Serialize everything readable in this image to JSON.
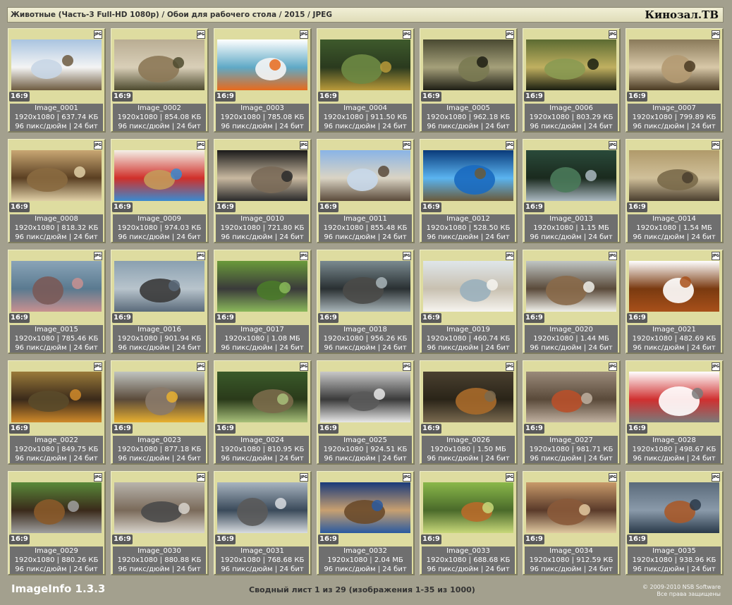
{
  "header": {
    "title": "Животные (Часть-3 Full-HD 1080p) / Обои для рабочего стола / 2015 / JPEG",
    "brand": "Кинозал.ТВ"
  },
  "footer": {
    "app_name": "ImageInfo 1.3.3",
    "summary": "Сводный лист 1 из 29 (изображения 1-35 из 1000)",
    "copyright_line1": "© 2009-2010 NSB Software",
    "copyright_line2": "Все права защищены"
  },
  "format_badge": "JPG",
  "images": [
    {
      "name": "Image_0001",
      "dims": "1920x1080",
      "size": "637.74 КБ",
      "ratio": "16:9",
      "dpi": "96 пикс/дюйм",
      "bits": "24 бит",
      "colors": [
        "#a9c4e0",
        "#c8d6e6",
        "#6d5b3f",
        "#f4f4f4"
      ]
    },
    {
      "name": "Image_0002",
      "dims": "1920x1080",
      "size": "854.08 КБ",
      "ratio": "16:9",
      "dpi": "96 пикс/дюйм",
      "bits": "24 бит",
      "colors": [
        "#b9ad93",
        "#8c7856",
        "#4d4a2e",
        "#d9cfb8"
      ]
    },
    {
      "name": "Image_0003",
      "dims": "1920x1080",
      "size": "785.08 КБ",
      "ratio": "16:9",
      "dpi": "96 пикс/дюйм",
      "bits": "24 бит",
      "colors": [
        "#ffffff",
        "#f5f5f5",
        "#e86a1c",
        "#5fa9c6"
      ]
    },
    {
      "name": "Image_0004",
      "dims": "1920x1080",
      "size": "911.50 КБ",
      "ratio": "16:9",
      "dpi": "96 пикс/дюйм",
      "bits": "24 бит",
      "colors": [
        "#3e5a2c",
        "#6e8a44",
        "#b99a3a",
        "#2a3a1e"
      ]
    },
    {
      "name": "Image_0005",
      "dims": "1920x1080",
      "size": "962.18 КБ",
      "ratio": "16:9",
      "dpi": "96 пикс/дюйм",
      "bits": "24 бит",
      "colors": [
        "#4a4a32",
        "#7a7a52",
        "#1e1e14",
        "#a5a07a"
      ]
    },
    {
      "name": "Image_0006",
      "dims": "1920x1080",
      "size": "803.29 КБ",
      "ratio": "16:9",
      "dpi": "96 пикс/дюйм",
      "bits": "24 бит",
      "colors": [
        "#5c6b32",
        "#8a9a52",
        "#1a1e10",
        "#c0b060"
      ]
    },
    {
      "name": "Image_0007",
      "dims": "1920x1080",
      "size": "799.89 КБ",
      "ratio": "16:9",
      "dpi": "96 пикс/дюйм",
      "bits": "24 бит",
      "colors": [
        "#8a7a5a",
        "#b49a72",
        "#4a3a22",
        "#d8c8a8"
      ]
    },
    {
      "name": "Image_0008",
      "dims": "1920x1080",
      "size": "818.32 КБ",
      "ratio": "16:9",
      "dpi": "96 пикс/дюйм",
      "bits": "24 бит",
      "colors": [
        "#c9a773",
        "#8a6a40",
        "#e0cfa6",
        "#5a3f22"
      ]
    },
    {
      "name": "Image_0009",
      "dims": "1920x1080",
      "size": "974.03 КБ",
      "ratio": "16:9",
      "dpi": "96 пикс/дюйм",
      "bits": "24 бит",
      "colors": [
        "#f4f0e8",
        "#c49a5a",
        "#3a8ad0",
        "#d0302a"
      ]
    },
    {
      "name": "Image_0010",
      "dims": "1920x1080",
      "size": "721.80 КБ",
      "ratio": "16:9",
      "dpi": "96 пикс/дюйм",
      "bits": "24 бит",
      "colors": [
        "#1a1a1a",
        "#7a6a58",
        "#2a2a2a",
        "#c8b8a0"
      ]
    },
    {
      "name": "Image_0011",
      "dims": "1920x1080",
      "size": "855.48 КБ",
      "ratio": "16:9",
      "dpi": "96 пикс/дюйм",
      "bits": "24 бит",
      "colors": [
        "#8ab4e6",
        "#c8d8ea",
        "#5a4a3a",
        "#dad4c4"
      ]
    },
    {
      "name": "Image_0012",
      "dims": "1920x1080",
      "size": "528.50 КБ",
      "ratio": "16:9",
      "dpi": "96 пикс/дюйм",
      "bits": "24 бит",
      "colors": [
        "#0a3a7a",
        "#1a6ac0",
        "#6a5a3a",
        "#5ab4f0"
      ]
    },
    {
      "name": "Image_0013",
      "dims": "1920x1080",
      "size": "1.15 МБ",
      "ratio": "16:9",
      "dpi": "96 пикс/дюйм",
      "bits": "24 бит",
      "colors": [
        "#2a4a3a",
        "#4a7a5a",
        "#aab8c0",
        "#1a2a1e"
      ]
    },
    {
      "name": "Image_0014",
      "dims": "1920x1080",
      "size": "1.54 МБ",
      "ratio": "16:9",
      "dpi": "96 пикс/дюйм",
      "bits": "24 бит",
      "colors": [
        "#b09a6a",
        "#7a6a4a",
        "#4a3e2e",
        "#d0c09a"
      ]
    },
    {
      "name": "Image_0015",
      "dims": "1920x1080",
      "size": "785.46 КБ",
      "ratio": "16:9",
      "dpi": "96 пикс/дюйм",
      "bits": "24 бит",
      "colors": [
        "#8aa4b8",
        "#7a5a58",
        "#c89090",
        "#5a7a90"
      ]
    },
    {
      "name": "Image_0016",
      "dims": "1920x1080",
      "size": "901.94 КБ",
      "ratio": "16:9",
      "dpi": "96 пикс/дюйм",
      "bits": "24 бит",
      "colors": [
        "#8aa0b0",
        "#3a3a3a",
        "#5a6a7a",
        "#b8c4cc"
      ]
    },
    {
      "name": "Image_0017",
      "dims": "1920x1080",
      "size": "1.08 МБ",
      "ratio": "16:9",
      "dpi": "96 пикс/дюйм",
      "bits": "24 бит",
      "colors": [
        "#6a9a3a",
        "#4a7a2a",
        "#8ab85a",
        "#3a3a3a"
      ]
    },
    {
      "name": "Image_0018",
      "dims": "1920x1080",
      "size": "956.26 КБ",
      "ratio": "16:9",
      "dpi": "96 пикс/дюйм",
      "bits": "24 бит",
      "colors": [
        "#7a8a90",
        "#4a4a48",
        "#a8b4b8",
        "#2a3032"
      ]
    },
    {
      "name": "Image_0019",
      "dims": "1920x1080",
      "size": "460.74 КБ",
      "ratio": "16:9",
      "dpi": "96 пикс/дюйм",
      "bits": "24 бит",
      "colors": [
        "#dfe6ea",
        "#9ab0bc",
        "#f6f4f0",
        "#c8c0b0"
      ]
    },
    {
      "name": "Image_0020",
      "dims": "1920x1080",
      "size": "1.44 МБ",
      "ratio": "16:9",
      "dpi": "96 пикс/дюйм",
      "bits": "24 бит",
      "colors": [
        "#c0c6c4",
        "#8a6a4a",
        "#f0f0ea",
        "#5a4a3a"
      ]
    },
    {
      "name": "Image_0021",
      "dims": "1920x1080",
      "size": "482.69 КБ",
      "ratio": "16:9",
      "dpi": "96 пикс/дюйм",
      "bits": "24 бит",
      "colors": [
        "#ffffff",
        "#ffffff",
        "#a8501a",
        "#7a3a10"
      ]
    },
    {
      "name": "Image_0022",
      "dims": "1920x1080",
      "size": "849.75 КБ",
      "ratio": "16:9",
      "dpi": "96 пикс/дюйм",
      "bits": "24 бит",
      "colors": [
        "#9a7a3a",
        "#5a4a2a",
        "#d08a2a",
        "#3a2a1a"
      ]
    },
    {
      "name": "Image_0023",
      "dims": "1920x1080",
      "size": "877.18 КБ",
      "ratio": "16:9",
      "dpi": "96 пикс/дюйм",
      "bits": "24 бит",
      "colors": [
        "#c0c4c0",
        "#8a7a6a",
        "#e8b030",
        "#5a4a3a"
      ]
    },
    {
      "name": "Image_0024",
      "dims": "1920x1080",
      "size": "810.95 КБ",
      "ratio": "16:9",
      "dpi": "96 пикс/дюйм",
      "bits": "24 бит",
      "colors": [
        "#3a5a2a",
        "#7a6a4a",
        "#a8c07a",
        "#2a3a1a"
      ]
    },
    {
      "name": "Image_0025",
      "dims": "1920x1080",
      "size": "924.51 КБ",
      "ratio": "16:9",
      "dpi": "96 пикс/дюйм",
      "bits": "24 бит",
      "colors": [
        "#c8c8c8",
        "#5a5a5a",
        "#e8e8e8",
        "#3a3a3a"
      ]
    },
    {
      "name": "Image_0026",
      "dims": "1920x1080",
      "size": "1.50 МБ",
      "ratio": "16:9",
      "dpi": "96 пикс/дюйм",
      "bits": "24 бит",
      "colors": [
        "#4a4030",
        "#a86a2a",
        "#7a6a50",
        "#2a2418"
      ]
    },
    {
      "name": "Image_0027",
      "dims": "1920x1080",
      "size": "981.71 КБ",
      "ratio": "16:9",
      "dpi": "96 пикс/дюйм",
      "bits": "24 бит",
      "colors": [
        "#9a8a7a",
        "#b8502a",
        "#c0b0a0",
        "#5a4a3a"
      ]
    },
    {
      "name": "Image_0028",
      "dims": "1920x1080",
      "size": "498.67 КБ",
      "ratio": "16:9",
      "dpi": "96 пикс/дюйм",
      "bits": "24 бит",
      "colors": [
        "#ffffff",
        "#ffffff",
        "#7a7a7a",
        "#d03030"
      ]
    },
    {
      "name": "Image_0029",
      "dims": "1920x1080",
      "size": "880.26 КБ",
      "ratio": "16:9",
      "dpi": "96 пикс/дюйм",
      "bits": "24 бит",
      "colors": [
        "#5a8a3a",
        "#8a5a2a",
        "#a0a0a0",
        "#3a2a1a"
      ]
    },
    {
      "name": "Image_0030",
      "dims": "1920x1080",
      "size": "880.88 КБ",
      "ratio": "16:9",
      "dpi": "96 пикс/дюйм",
      "bits": "24 бит",
      "colors": [
        "#b8b4ac",
        "#4a4a4a",
        "#d8d4cc",
        "#7a6a5a"
      ]
    },
    {
      "name": "Image_0031",
      "dims": "1920x1080",
      "size": "768.68 КБ",
      "ratio": "16:9",
      "dpi": "96 пикс/дюйм",
      "bits": "24 бит",
      "colors": [
        "#a8b4c0",
        "#5a5a5a",
        "#d8dce0",
        "#3a4a5a"
      ]
    },
    {
      "name": "Image_0032",
      "dims": "1920x1080",
      "size": "2.04 МБ",
      "ratio": "16:9",
      "dpi": "96 пикс/дюйм",
      "bits": "24 бит",
      "colors": [
        "#1a3a7a",
        "#6a4a2a",
        "#2a5aa0",
        "#c8a070"
      ]
    },
    {
      "name": "Image_0033",
      "dims": "1920x1080",
      "size": "688.68 КБ",
      "ratio": "16:9",
      "dpi": "96 пикс/дюйм",
      "bits": "24 бит",
      "colors": [
        "#8ab84a",
        "#b86a2a",
        "#c8d87a",
        "#4a6a2a"
      ]
    },
    {
      "name": "Image_0034",
      "dims": "1920x1080",
      "size": "912.59 КБ",
      "ratio": "16:9",
      "dpi": "96 пикс/дюйм",
      "bits": "24 бит",
      "colors": [
        "#c89a6a",
        "#8a5a3a",
        "#e0c8a0",
        "#5a3a2a"
      ]
    },
    {
      "name": "Image_0035",
      "dims": "1920x1080",
      "size": "938.96 КБ",
      "ratio": "16:9",
      "dpi": "96 пикс/дюйм",
      "bits": "24 бит",
      "colors": [
        "#5a6a7a",
        "#a85a2a",
        "#2a3a4a",
        "#8a9aaa"
      ]
    }
  ]
}
